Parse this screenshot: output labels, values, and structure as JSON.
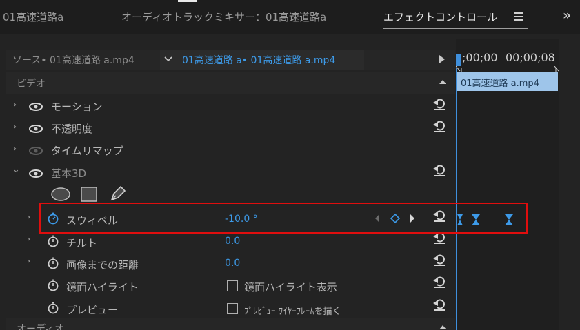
{
  "tabs": [
    {
      "label": "01高速道路a",
      "active": false
    },
    {
      "label": "オーディオトラックミキサー：01高速道路a",
      "active": false
    },
    {
      "label": "エフェクトコントロール",
      "active": true
    }
  ],
  "panel_menu_icon": "hamburger-menu-icon",
  "overflow_icon": "double-chevron-right-icon",
  "header": {
    "source_label": "ソース• 01高速道路 a.mp4",
    "sequence_link": "01高速道路 a• 01高速道路 a.mp4"
  },
  "timeline": {
    "time_start": ";00;00",
    "time_end": "00;00;08",
    "clip_label": "01高速道路 a.mp4"
  },
  "sections": {
    "video": "ビデオ",
    "audio": "オーディオ"
  },
  "effects": [
    {
      "label": "モーション",
      "eye": true,
      "reset": true
    },
    {
      "label": "不透明度",
      "eye": true,
      "reset": true
    },
    {
      "label": "タイムリマップ",
      "eye": false,
      "reset": false
    },
    {
      "label": "基本3D",
      "eye": true,
      "reset": true,
      "expanded": true
    }
  ],
  "shape_tools": [
    "ellipse-mask-icon",
    "rectangle-mask-icon",
    "pen-mask-icon"
  ],
  "properties": [
    {
      "label": "スウィベル",
      "value": "-10.0 °",
      "animating": true,
      "highlighted": true
    },
    {
      "label": "チルト",
      "value": "0.0"
    },
    {
      "label": "画像までの距離",
      "value": "0.0"
    },
    {
      "label": "鏡面ハイライト",
      "checkbox_label": "鏡面ハイライト表示",
      "checked": false
    },
    {
      "label": "プレビュー",
      "checkbox_label": "ﾌﾟﾚﾋﾞｭｰ ﾜｲﾔｰﾌﾚｰﾑを描く",
      "checked": false
    }
  ],
  "colors": {
    "accent": "#3d9ae8",
    "highlight_box": "#e00e0e",
    "clip": "#9ec5ea"
  }
}
